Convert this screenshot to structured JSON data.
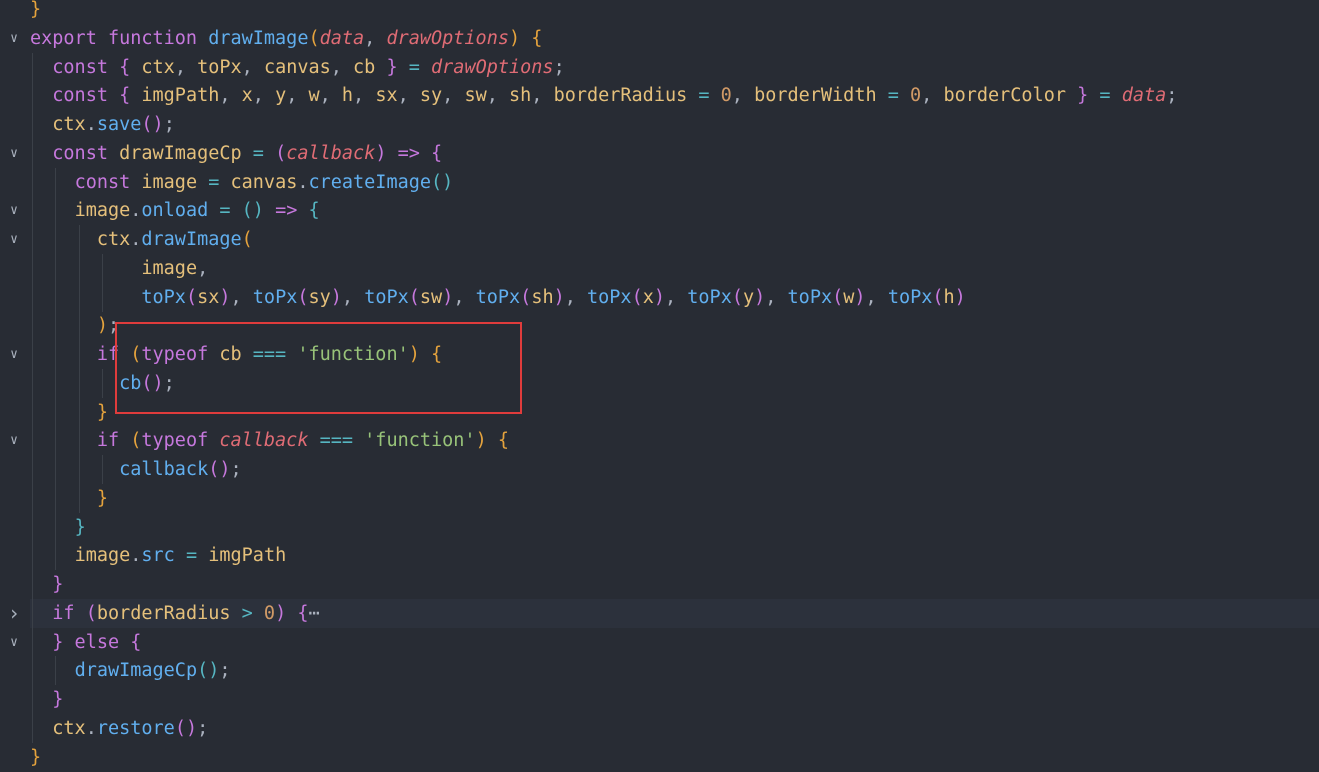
{
  "editor": {
    "lines": [
      {
        "fold": "",
        "hl": false,
        "guides": [],
        "tokens": [
          [
            "}",
            "b1"
          ]
        ]
      },
      {
        "fold": "v",
        "hl": false,
        "guides": [],
        "tokens": [
          [
            "export ",
            "kw"
          ],
          [
            "function ",
            "kw"
          ],
          [
            "drawImage",
            "fn"
          ],
          [
            "(",
            "b1"
          ],
          [
            "data",
            "prm"
          ],
          [
            ", ",
            "pun"
          ],
          [
            "drawOptions",
            "prm"
          ],
          [
            ") ",
            "b1"
          ],
          [
            "{",
            "b1"
          ]
        ]
      },
      {
        "fold": "",
        "hl": false,
        "guides": [
          1
        ],
        "tokens": [
          [
            "  ",
            "pun"
          ],
          [
            "const ",
            "kw"
          ],
          [
            "{ ",
            "b2"
          ],
          [
            "ctx",
            "var"
          ],
          [
            ", ",
            "pun"
          ],
          [
            "toPx",
            "var"
          ],
          [
            ", ",
            "pun"
          ],
          [
            "canvas",
            "var"
          ],
          [
            ", ",
            "pun"
          ],
          [
            "cb",
            "var"
          ],
          [
            " }",
            "b2"
          ],
          [
            " = ",
            "op"
          ],
          [
            "drawOptions",
            "prm"
          ],
          [
            ";",
            "pun"
          ]
        ]
      },
      {
        "fold": "",
        "hl": false,
        "guides": [
          1
        ],
        "tokens": [
          [
            "  ",
            "pun"
          ],
          [
            "const ",
            "kw"
          ],
          [
            "{ ",
            "b2"
          ],
          [
            "imgPath",
            "var"
          ],
          [
            ", ",
            "pun"
          ],
          [
            "x",
            "var"
          ],
          [
            ", ",
            "pun"
          ],
          [
            "y",
            "var"
          ],
          [
            ", ",
            "pun"
          ],
          [
            "w",
            "var"
          ],
          [
            ", ",
            "pun"
          ],
          [
            "h",
            "var"
          ],
          [
            ", ",
            "pun"
          ],
          [
            "sx",
            "var"
          ],
          [
            ", ",
            "pun"
          ],
          [
            "sy",
            "var"
          ],
          [
            ", ",
            "pun"
          ],
          [
            "sw",
            "var"
          ],
          [
            ", ",
            "pun"
          ],
          [
            "sh",
            "var"
          ],
          [
            ", ",
            "pun"
          ],
          [
            "borderRadius",
            "var"
          ],
          [
            " = ",
            "op"
          ],
          [
            "0",
            "num"
          ],
          [
            ", ",
            "pun"
          ],
          [
            "borderWidth",
            "var"
          ],
          [
            " = ",
            "op"
          ],
          [
            "0",
            "num"
          ],
          [
            ", ",
            "pun"
          ],
          [
            "borderColor",
            "var"
          ],
          [
            " }",
            "b2"
          ],
          [
            " = ",
            "op"
          ],
          [
            "data",
            "prm"
          ],
          [
            ";",
            "pun"
          ]
        ]
      },
      {
        "fold": "",
        "hl": false,
        "guides": [
          1
        ],
        "tokens": [
          [
            "  ",
            "pun"
          ],
          [
            "ctx",
            "var"
          ],
          [
            ".",
            "pun"
          ],
          [
            "save",
            "fn"
          ],
          [
            "()",
            "b2"
          ],
          [
            ";",
            "pun"
          ]
        ]
      },
      {
        "fold": "v",
        "hl": false,
        "guides": [
          1
        ],
        "tokens": [
          [
            "  ",
            "pun"
          ],
          [
            "const ",
            "kw"
          ],
          [
            "drawImageCp",
            "var"
          ],
          [
            " = ",
            "op"
          ],
          [
            "(",
            "b2"
          ],
          [
            "callback",
            "prm"
          ],
          [
            ")",
            "b2"
          ],
          [
            " => ",
            "kw"
          ],
          [
            "{",
            "b2"
          ]
        ]
      },
      {
        "fold": "",
        "hl": false,
        "guides": [
          1,
          2
        ],
        "tokens": [
          [
            "    ",
            "pun"
          ],
          [
            "const ",
            "kw"
          ],
          [
            "image",
            "var"
          ],
          [
            " = ",
            "op"
          ],
          [
            "canvas",
            "var"
          ],
          [
            ".",
            "pun"
          ],
          [
            "createImage",
            "fn"
          ],
          [
            "()",
            "b3"
          ]
        ]
      },
      {
        "fold": "v",
        "hl": false,
        "guides": [
          1,
          2
        ],
        "tokens": [
          [
            "    ",
            "pun"
          ],
          [
            "image",
            "var"
          ],
          [
            ".",
            "pun"
          ],
          [
            "onload",
            "fn"
          ],
          [
            " = ",
            "op"
          ],
          [
            "()",
            "b3"
          ],
          [
            " => ",
            "kw"
          ],
          [
            "{",
            "b3"
          ]
        ]
      },
      {
        "fold": "v",
        "hl": false,
        "guides": [
          1,
          2,
          3
        ],
        "tokens": [
          [
            "      ",
            "pun"
          ],
          [
            "ctx",
            "var"
          ],
          [
            ".",
            "pun"
          ],
          [
            "drawImage",
            "fn"
          ],
          [
            "(",
            "b1"
          ]
        ]
      },
      {
        "fold": "",
        "hl": false,
        "guides": [
          1,
          2,
          3,
          4
        ],
        "tokens": [
          [
            "          ",
            "pun"
          ],
          [
            "image",
            "var"
          ],
          [
            ",",
            "pun"
          ]
        ]
      },
      {
        "fold": "",
        "hl": false,
        "guides": [
          1,
          2,
          3,
          4
        ],
        "tokens": [
          [
            "          ",
            "pun"
          ],
          [
            "toPx",
            "fn"
          ],
          [
            "(",
            "b2"
          ],
          [
            "sx",
            "var"
          ],
          [
            ")",
            "b2"
          ],
          [
            ", ",
            "pun"
          ],
          [
            "toPx",
            "fn"
          ],
          [
            "(",
            "b2"
          ],
          [
            "sy",
            "var"
          ],
          [
            ")",
            "b2"
          ],
          [
            ", ",
            "pun"
          ],
          [
            "toPx",
            "fn"
          ],
          [
            "(",
            "b2"
          ],
          [
            "sw",
            "var"
          ],
          [
            ")",
            "b2"
          ],
          [
            ", ",
            "pun"
          ],
          [
            "toPx",
            "fn"
          ],
          [
            "(",
            "b2"
          ],
          [
            "sh",
            "var"
          ],
          [
            ")",
            "b2"
          ],
          [
            ", ",
            "pun"
          ],
          [
            "toPx",
            "fn"
          ],
          [
            "(",
            "b2"
          ],
          [
            "x",
            "var"
          ],
          [
            ")",
            "b2"
          ],
          [
            ", ",
            "pun"
          ],
          [
            "toPx",
            "fn"
          ],
          [
            "(",
            "b2"
          ],
          [
            "y",
            "var"
          ],
          [
            ")",
            "b2"
          ],
          [
            ", ",
            "pun"
          ],
          [
            "toPx",
            "fn"
          ],
          [
            "(",
            "b2"
          ],
          [
            "w",
            "var"
          ],
          [
            ")",
            "b2"
          ],
          [
            ", ",
            "pun"
          ],
          [
            "toPx",
            "fn"
          ],
          [
            "(",
            "b2"
          ],
          [
            "h",
            "var"
          ],
          [
            ")",
            "b2"
          ]
        ]
      },
      {
        "fold": "",
        "hl": false,
        "guides": [
          1,
          2,
          3
        ],
        "tokens": [
          [
            "      ",
            "pun"
          ],
          [
            ")",
            "b1"
          ],
          [
            ";",
            "pun"
          ]
        ]
      },
      {
        "fold": "v",
        "hl": false,
        "guides": [
          1,
          2,
          3
        ],
        "tokens": [
          [
            "      ",
            "pun"
          ],
          [
            "if ",
            "kw"
          ],
          [
            "(",
            "b1"
          ],
          [
            "typeof ",
            "kw"
          ],
          [
            "cb",
            "var"
          ],
          [
            " === ",
            "op"
          ],
          [
            "'function'",
            "str"
          ],
          [
            ") ",
            "b1"
          ],
          [
            "{",
            "b1"
          ]
        ]
      },
      {
        "fold": "",
        "hl": false,
        "guides": [
          1,
          2,
          3,
          4
        ],
        "tokens": [
          [
            "        ",
            "pun"
          ],
          [
            "cb",
            "fn"
          ],
          [
            "()",
            "b2"
          ],
          [
            ";",
            "pun"
          ]
        ]
      },
      {
        "fold": "",
        "hl": false,
        "guides": [
          1,
          2,
          3
        ],
        "tokens": [
          [
            "      ",
            "pun"
          ],
          [
            "}",
            "b1"
          ]
        ]
      },
      {
        "fold": "v",
        "hl": false,
        "guides": [
          1,
          2,
          3
        ],
        "tokens": [
          [
            "      ",
            "pun"
          ],
          [
            "if ",
            "kw"
          ],
          [
            "(",
            "b1"
          ],
          [
            "typeof ",
            "kw"
          ],
          [
            "callback",
            "prm"
          ],
          [
            " === ",
            "op"
          ],
          [
            "'function'",
            "str"
          ],
          [
            ") ",
            "b1"
          ],
          [
            "{",
            "b1"
          ]
        ]
      },
      {
        "fold": "",
        "hl": false,
        "guides": [
          1,
          2,
          3,
          4
        ],
        "tokens": [
          [
            "        ",
            "pun"
          ],
          [
            "callback",
            "fn"
          ],
          [
            "()",
            "b2"
          ],
          [
            ";",
            "pun"
          ]
        ]
      },
      {
        "fold": "",
        "hl": false,
        "guides": [
          1,
          2,
          3
        ],
        "tokens": [
          [
            "      ",
            "pun"
          ],
          [
            "}",
            "b1"
          ]
        ]
      },
      {
        "fold": "",
        "hl": false,
        "guides": [
          1,
          2
        ],
        "tokens": [
          [
            "    ",
            "pun"
          ],
          [
            "}",
            "b3"
          ]
        ]
      },
      {
        "fold": "",
        "hl": false,
        "guides": [
          1,
          2
        ],
        "tokens": [
          [
            "    ",
            "pun"
          ],
          [
            "image",
            "var"
          ],
          [
            ".",
            "pun"
          ],
          [
            "src",
            "fn"
          ],
          [
            " = ",
            "op"
          ],
          [
            "imgPath",
            "var"
          ]
        ]
      },
      {
        "fold": "",
        "hl": false,
        "guides": [
          1
        ],
        "tokens": [
          [
            "  ",
            "pun"
          ],
          [
            "}",
            "b2"
          ]
        ]
      },
      {
        "fold": ">",
        "hl": true,
        "guides": [
          1
        ],
        "tokens": [
          [
            "  ",
            "pun"
          ],
          [
            "if ",
            "kw"
          ],
          [
            "(",
            "b2"
          ],
          [
            "borderRadius",
            "var"
          ],
          [
            " > ",
            "op"
          ],
          [
            "0",
            "num"
          ],
          [
            ") ",
            "b2"
          ],
          [
            "{",
            "b2"
          ],
          [
            "⋯",
            "ell"
          ]
        ]
      },
      {
        "fold": "v",
        "hl": false,
        "guides": [
          1
        ],
        "tokens": [
          [
            "  ",
            "pun"
          ],
          [
            "}",
            "b2"
          ],
          [
            " else ",
            "kw"
          ],
          [
            "{",
            "b2"
          ]
        ]
      },
      {
        "fold": "",
        "hl": false,
        "guides": [
          1,
          2
        ],
        "tokens": [
          [
            "    ",
            "pun"
          ],
          [
            "drawImageCp",
            "fn"
          ],
          [
            "()",
            "b3"
          ],
          [
            ";",
            "pun"
          ]
        ]
      },
      {
        "fold": "",
        "hl": false,
        "guides": [
          1
        ],
        "tokens": [
          [
            "  ",
            "pun"
          ],
          [
            "}",
            "b2"
          ]
        ]
      },
      {
        "fold": "",
        "hl": false,
        "guides": [
          1
        ],
        "tokens": [
          [
            "  ",
            "pun"
          ],
          [
            "ctx",
            "var"
          ],
          [
            ".",
            "pun"
          ],
          [
            "restore",
            "fn"
          ],
          [
            "()",
            "b2"
          ],
          [
            ";",
            "pun"
          ]
        ]
      },
      {
        "fold": "",
        "hl": false,
        "guides": [],
        "tokens": [
          [
            "}",
            "b1"
          ]
        ]
      }
    ]
  },
  "annotation": {
    "color": "#e03c3c"
  }
}
